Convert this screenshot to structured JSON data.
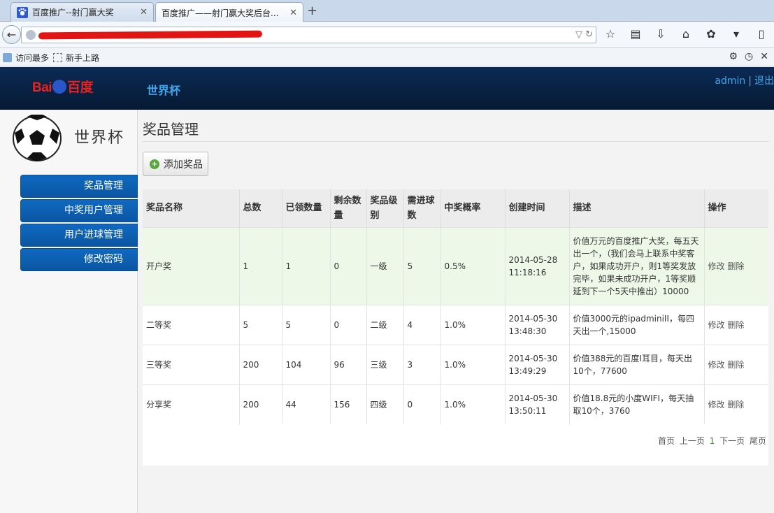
{
  "browser": {
    "tabs": [
      {
        "title": "百度推广--射门赢大奖",
        "active": false
      },
      {
        "title": "百度推广——射门赢大奖后台...",
        "active": true
      }
    ],
    "close_glyph": "✕",
    "new_tab_glyph": "+",
    "bookmarks": [
      "访问最多",
      "新手上路"
    ]
  },
  "header": {
    "logo": {
      "left": "Bai",
      "right": "百度"
    },
    "brand": "世界杯",
    "user": "admin",
    "separator": "|",
    "logout": "退出",
    "bg_color": "#061a33",
    "accent_color": "#3fa7ee"
  },
  "sidebar": {
    "site_name": "世界杯",
    "items": [
      {
        "label": "奖品管理"
      },
      {
        "label": "中奖用户管理"
      },
      {
        "label": "用户进球管理"
      },
      {
        "label": "修改密码"
      }
    ],
    "item_color": "#0b56a3"
  },
  "main": {
    "title": "奖品管理",
    "add_label": "添加奖品",
    "columns": [
      "奖品名称",
      "总数",
      "已领数量",
      "剩余数量",
      "奖品级别",
      "需进球数",
      "中奖概率",
      "创建时间",
      "描述",
      "操作"
    ],
    "rows": [
      {
        "name": "开户奖",
        "total": "1",
        "claimed": "1",
        "remaining": "0",
        "level": "一级",
        "goals": "5",
        "rate": "0.5%",
        "created": "2014-05-28 11:18:16",
        "desc": "价值万元的百度推广大奖，每五天出一个，（我们会马上联系中奖客户，如果成功开户，则1等奖发放完毕，如果未成功开户，1等奖顺延到下一个5天中推出）10000",
        "edit": "修改",
        "delete": "删除"
      },
      {
        "name": "二等奖",
        "total": "5",
        "claimed": "5",
        "remaining": "0",
        "level": "二级",
        "goals": "4",
        "rate": "1.0%",
        "created": "2014-05-30 13:48:30",
        "desc": "价值3000元的ipadminiII，每四天出一个,15000",
        "edit": "修改",
        "delete": "删除"
      },
      {
        "name": "三等奖",
        "total": "200",
        "claimed": "104",
        "remaining": "96",
        "level": "三级",
        "goals": "3",
        "rate": "1.0%",
        "created": "2014-05-30 13:49:29",
        "desc": "价值388元的百度I耳目，每天出10个，77600",
        "edit": "修改",
        "delete": "删除"
      },
      {
        "name": "分享奖",
        "total": "200",
        "claimed": "44",
        "remaining": "156",
        "level": "四级",
        "goals": "0",
        "rate": "1.0%",
        "created": "2014-05-30 13:50:11",
        "desc": "价值18.8元的小度WIFI，每天抽取10个，3760",
        "edit": "修改",
        "delete": "删除"
      }
    ],
    "pager": {
      "first": "首页",
      "prev": "上一页",
      "current": "1",
      "next": "下一页",
      "last": "尾页"
    },
    "highlight_color": "#eef8e8"
  }
}
